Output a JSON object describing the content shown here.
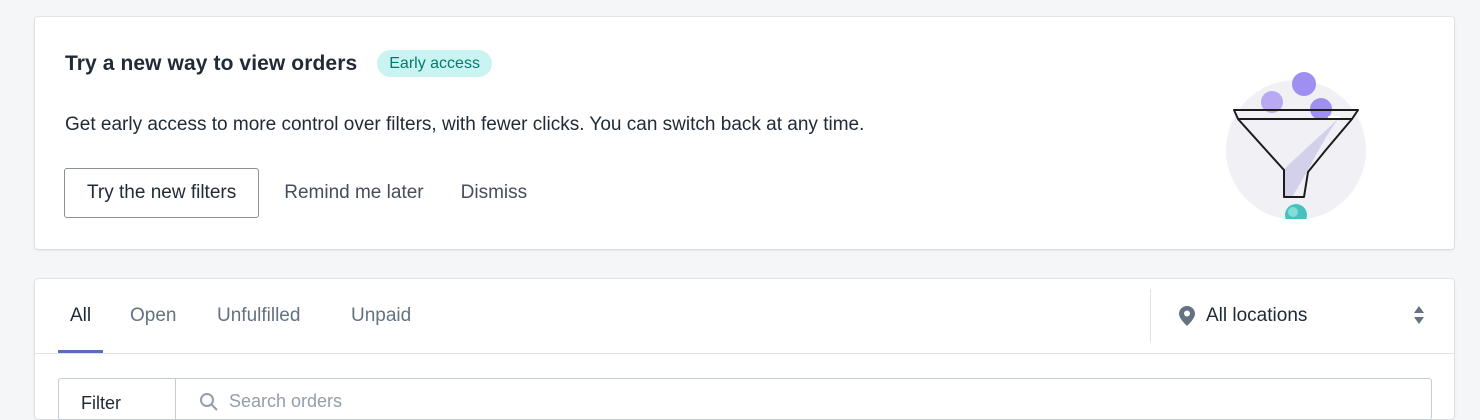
{
  "banner": {
    "title": "Try a new way to view orders",
    "badge": "Early access",
    "description": "Get early access to more control over filters, with fewer clicks. You can switch back at any time.",
    "primary_label": "Try the new filters",
    "remind_label": "Remind me later",
    "dismiss_label": "Dismiss",
    "illustration_icon": "funnel-illustration"
  },
  "tabs": [
    {
      "label": "All",
      "active": true
    },
    {
      "label": "Open",
      "active": false
    },
    {
      "label": "Unfulfilled",
      "active": false
    },
    {
      "label": "Unpaid",
      "active": false
    }
  ],
  "location": {
    "label": "All locations",
    "icon": "location-pin-icon"
  },
  "filter": {
    "button_label": "Filter",
    "search_placeholder": "Search orders"
  },
  "colors": {
    "accent": "#5c6ac4",
    "badge_bg": "#c9f4f1",
    "badge_text": "#047a72",
    "teal": "#47c1bf",
    "purple": "#9c6ade"
  }
}
